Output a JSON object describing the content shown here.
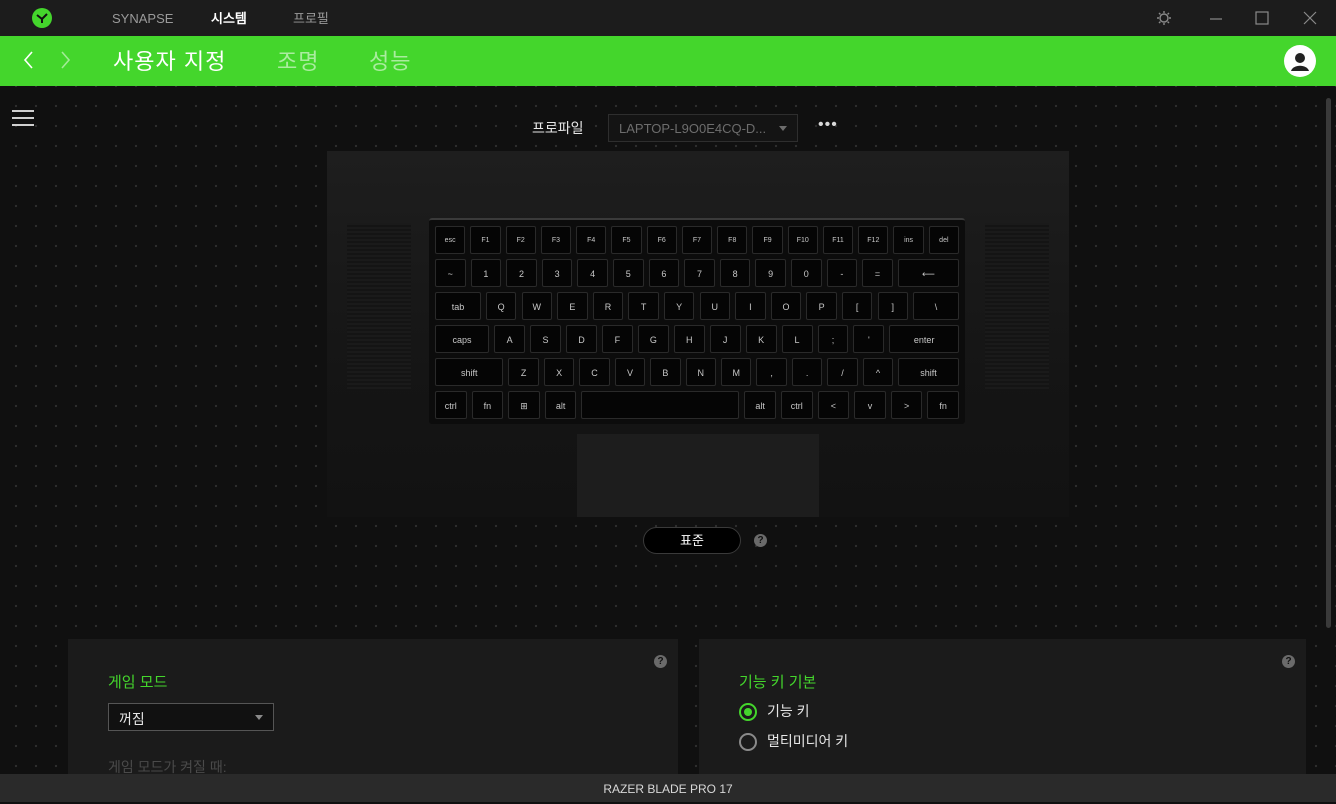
{
  "titlebar": {
    "nav": [
      "SYNAPSE",
      "시스템",
      "프로필"
    ],
    "active_index": 1
  },
  "subbar": {
    "tabs": [
      "사용자 지정",
      "조명",
      "성능"
    ],
    "active_index": 0
  },
  "profile": {
    "label": "프로파일",
    "selected": "LAPTOP-L9O0E4CQ-D...",
    "more": "•••"
  },
  "keyboard": {
    "rows": [
      [
        {
          "t": "esc"
        },
        {
          "t": "F1"
        },
        {
          "t": "F2"
        },
        {
          "t": "F3"
        },
        {
          "t": "F4"
        },
        {
          "t": "F5"
        },
        {
          "t": "F6"
        },
        {
          "t": "F7"
        },
        {
          "t": "F8"
        },
        {
          "t": "F9"
        },
        {
          "t": "F10"
        },
        {
          "t": "F11"
        },
        {
          "t": "F12"
        },
        {
          "t": "ins"
        },
        {
          "t": "del"
        }
      ],
      [
        {
          "t": "~"
        },
        {
          "t": "1"
        },
        {
          "t": "2"
        },
        {
          "t": "3"
        },
        {
          "t": "4"
        },
        {
          "t": "5"
        },
        {
          "t": "6"
        },
        {
          "t": "7"
        },
        {
          "t": "8"
        },
        {
          "t": "9"
        },
        {
          "t": "0"
        },
        {
          "t": "-"
        },
        {
          "t": "="
        },
        {
          "t": "⟵"
        }
      ],
      [
        {
          "t": "tab"
        },
        {
          "t": "Q"
        },
        {
          "t": "W"
        },
        {
          "t": "E"
        },
        {
          "t": "R"
        },
        {
          "t": "T"
        },
        {
          "t": "Y"
        },
        {
          "t": "U"
        },
        {
          "t": "I"
        },
        {
          "t": "O"
        },
        {
          "t": "P"
        },
        {
          "t": "["
        },
        {
          "t": "]"
        },
        {
          "t": "\\"
        }
      ],
      [
        {
          "t": "caps"
        },
        {
          "t": "A"
        },
        {
          "t": "S"
        },
        {
          "t": "D"
        },
        {
          "t": "F"
        },
        {
          "t": "G"
        },
        {
          "t": "H"
        },
        {
          "t": "J"
        },
        {
          "t": "K"
        },
        {
          "t": "L"
        },
        {
          "t": ";"
        },
        {
          "t": "'"
        },
        {
          "t": "enter"
        }
      ],
      [
        {
          "t": "shift"
        },
        {
          "t": "Z"
        },
        {
          "t": "X"
        },
        {
          "t": "C"
        },
        {
          "t": "V"
        },
        {
          "t": "B"
        },
        {
          "t": "N"
        },
        {
          "t": "M"
        },
        {
          "t": ","
        },
        {
          "t": "."
        },
        {
          "t": "/"
        },
        {
          "t": "^"
        },
        {
          "t": "shift"
        }
      ],
      [
        {
          "t": "ctrl"
        },
        {
          "t": "fn"
        },
        {
          "t": "⊞"
        },
        {
          "t": "alt"
        },
        {
          "t": ""
        },
        {
          "t": "alt"
        },
        {
          "t": "ctrl"
        },
        {
          "t": "<"
        },
        {
          "t": "v"
        },
        {
          "t": ">"
        },
        {
          "t": "fn"
        }
      ]
    ]
  },
  "standard_button": "표준",
  "help_glyph": "?",
  "game_mode": {
    "title": "게임 모드",
    "value": "꺼짐",
    "subtitle": "게임 모드가 켜질 때:"
  },
  "fn_keys": {
    "title": "기능 키 기본",
    "options": [
      "기능 키",
      "멀티미디어 키"
    ],
    "selected_index": 0
  },
  "footer": "RAZER BLADE PRO 17"
}
